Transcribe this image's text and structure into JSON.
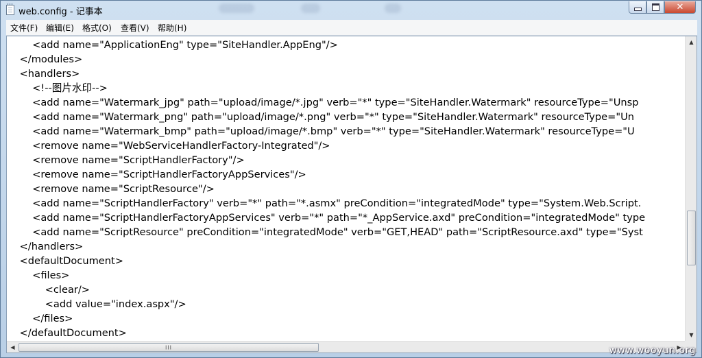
{
  "window": {
    "title": "web.config - 记事本"
  },
  "menu": [
    "文件(F)",
    "编辑(E)",
    "格式(O)",
    "查看(V)",
    "帮助(H)"
  ],
  "editor": {
    "lines": [
      "        <add name=\"ApplicationEng\" type=\"SiteHandler.AppEng\"/>",
      "    </modules>",
      "    <handlers>",
      "        <!--图片水印-->",
      "        <add name=\"Watermark_jpg\" path=\"upload/image/*.jpg\" verb=\"*\" type=\"SiteHandler.Watermark\" resourceType=\"Unsp",
      "        <add name=\"Watermark_png\" path=\"upload/image/*.png\" verb=\"*\" type=\"SiteHandler.Watermark\" resourceType=\"Un",
      "        <add name=\"Watermark_bmp\" path=\"upload/image/*.bmp\" verb=\"*\" type=\"SiteHandler.Watermark\" resourceType=\"U",
      "        <remove name=\"WebServiceHandlerFactory-Integrated\"/>",
      "        <remove name=\"ScriptHandlerFactory\"/>",
      "        <remove name=\"ScriptHandlerFactoryAppServices\"/>",
      "        <remove name=\"ScriptResource\"/>",
      "        <add name=\"ScriptHandlerFactory\" verb=\"*\" path=\"*.asmx\" preCondition=\"integratedMode\" type=\"System.Web.Script.",
      "        <add name=\"ScriptHandlerFactoryAppServices\" verb=\"*\" path=\"*_AppService.axd\" preCondition=\"integratedMode\" type",
      "        <add name=\"ScriptResource\" preCondition=\"integratedMode\" verb=\"GET,HEAD\" path=\"ScriptResource.axd\" type=\"Syst",
      "    </handlers>",
      "    <defaultDocument>",
      "        <files>",
      "            <clear/>",
      "            <add value=\"index.aspx\"/>",
      "        </files>",
      "    </defaultDocument>"
    ]
  },
  "scrollbars": {
    "grip": "III"
  },
  "watermark": "www.wooyun.org"
}
